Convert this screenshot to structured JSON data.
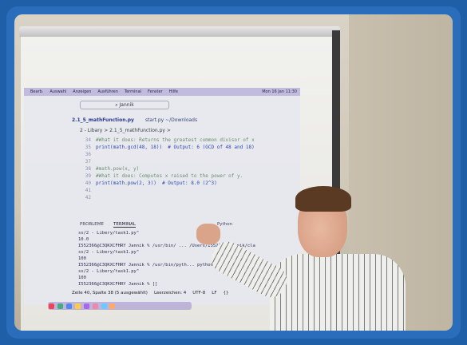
{
  "menubar": [
    "Bearb.",
    "Auswahl",
    "Anzeigen",
    "Ausführen",
    "Terminal",
    "Fenster",
    "Hilfe"
  ],
  "clock": "Mon 16 Jan 11:30",
  "search": "Jannik",
  "tabs": [
    "2.1_5_mathFunction.py",
    "start.py ~/Downloads"
  ],
  "breadcrumb": "2 - Libary > 2.1_5_mathFunction.py >",
  "code": [
    {
      "n": "34",
      "text": "#What it does: Returns the greatest common divisor of x"
    },
    {
      "n": "35",
      "text": "print(math.gcd(48, 18))  # Output: 6 (GCD of 48 and 18)"
    },
    {
      "n": "36",
      "text": ""
    },
    {
      "n": "37",
      "text": ""
    },
    {
      "n": "38",
      "text": "#math.pow(x, y)"
    },
    {
      "n": "39",
      "text": "#What it does: Computes x raised to the power of y."
    },
    {
      "n": "40",
      "text": "print(math.pow(2, 3))  # Output: 8.0 (2^3)"
    },
    {
      "n": "41",
      "text": ""
    },
    {
      "n": "42",
      "text": ""
    }
  ],
  "panel": {
    "problems": "PROBLEME",
    "terminal": "TERMINAL",
    "shell": "Python"
  },
  "terminal": [
    "ss/2 - Libery/task1.py\"",
    "10.0",
    "I552366@C3QKXCFHRY Jannik % /usr/bin/ ... /Users/I552366/Jannik/cla",
    "ss/2 - Libery/task1.py\"",
    "100",
    "I552366@C3QKXCFHRY Jannik % /usr/bin/pyth... python  ... 366/Jannik/cl",
    "ss/2 - Libery/task1.py\"",
    "100",
    "I552366@C3QKXCFHRY Jannik % []"
  ],
  "status": [
    "Zeile 40, Spalte 38 (5 ausgewählt)",
    "Leerzeichen: 4",
    "UTF-8",
    "LF",
    "{}"
  ]
}
